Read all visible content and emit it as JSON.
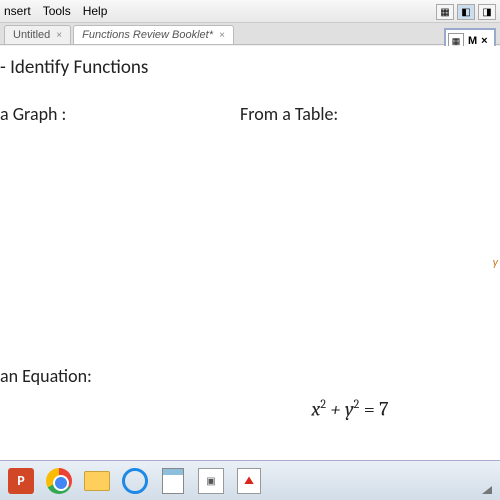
{
  "menu": {
    "insert": "nsert",
    "tools": "Tools",
    "help": "Help"
  },
  "tabs": {
    "tab1": "Untitled",
    "tab2": "Functions Review Booklet*"
  },
  "floatPanel": {
    "label": "M",
    "close": "×"
  },
  "content": {
    "heading": "- Identify Functions",
    "fromGraph": "a Graph :",
    "fromTable": "From a Table:",
    "fromEquation": "an Equation:",
    "eq_x": "x",
    "eq_sq1": "2",
    "eq_plus": " + ",
    "eq_y": "y",
    "eq_sq2": "2",
    "eq_eq": " = 7"
  },
  "sideMarker": "y",
  "taskbar": {
    "ppt": "P"
  }
}
